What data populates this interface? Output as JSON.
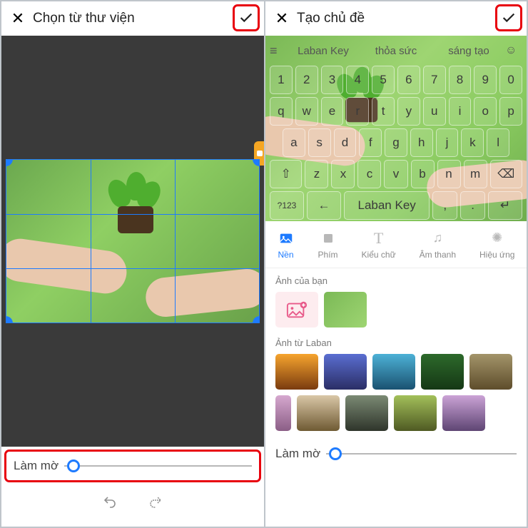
{
  "left": {
    "title": "Chọn từ thư viện",
    "slider_label": "Làm mờ"
  },
  "right": {
    "title": "Tạo chủ đề",
    "suggestions": {
      "w1": "Laban Key",
      "w2": "thỏa sức",
      "w3": "sáng tạo"
    },
    "keyboard": {
      "row1": [
        "1",
        "2",
        "3",
        "4",
        "5",
        "6",
        "7",
        "8",
        "9",
        "0"
      ],
      "row2": [
        "q",
        "w",
        "e",
        "r",
        "t",
        "y",
        "u",
        "i",
        "o",
        "p"
      ],
      "row3": [
        "a",
        "s",
        "d",
        "f",
        "g",
        "h",
        "j",
        "k",
        "l"
      ],
      "row4": [
        "⇧",
        "z",
        "x",
        "c",
        "v",
        "b",
        "n",
        "m",
        "⌫"
      ],
      "row5": [
        "?123",
        "←",
        "Laban Key",
        ",",
        ".",
        "↵"
      ]
    },
    "tabs": {
      "nen": "Nền",
      "phim": "Phím",
      "kieu_chu": "Kiểu chữ",
      "am_thanh": "Âm thanh",
      "hieu_ung": "Hiệu ứng"
    },
    "sections": {
      "your_images": "Ảnh của bạn",
      "laban_images": "Ảnh từ Laban"
    },
    "slider_label": "Làm mờ"
  }
}
